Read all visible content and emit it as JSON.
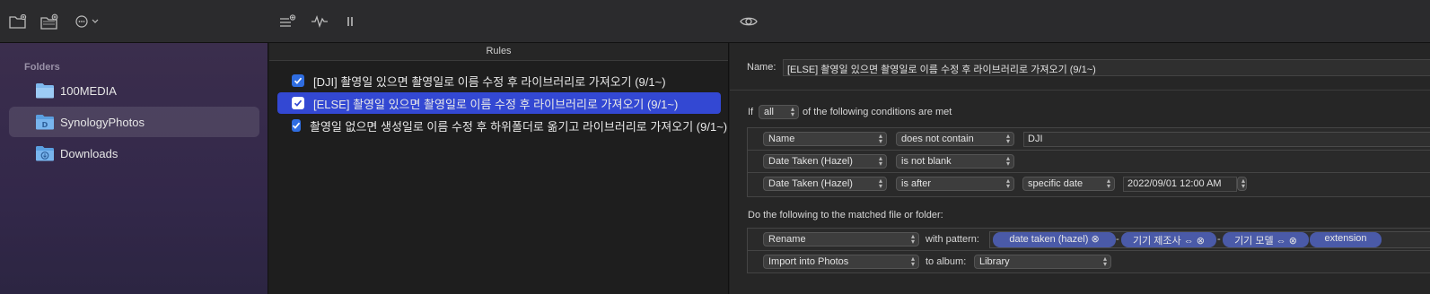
{
  "toolbar": {
    "icons": [
      "new-folder-icon",
      "add-folder-icon",
      "more-options-icon",
      "add-rule-icon",
      "activity-icon",
      "pause-icon",
      "preview-icon"
    ]
  },
  "sidebar": {
    "header": "Folders",
    "items": [
      {
        "label": "100MEDIA",
        "selected": false
      },
      {
        "label": "SynologyPhotos",
        "selected": true
      },
      {
        "label": "Downloads",
        "selected": false
      }
    ]
  },
  "rules": {
    "header": "Rules",
    "items": [
      {
        "label": "[DJI] 촬영일 있으면 촬영일로 이름 수정 후 라이브러리로 가져오기 (9/1~)",
        "checked": true,
        "selected": false
      },
      {
        "label": "[ELSE] 촬영일 있으면 촬영일로 이름 수정 후 라이브러리로 가져오기 (9/1~)",
        "checked": true,
        "selected": true
      },
      {
        "label": "촬영일 없으면 생성일로 이름 수정 후 하위폴더로 옮기고 라이브러리로 가져오기 (9/1~)",
        "checked": true,
        "selected": false
      }
    ]
  },
  "detail": {
    "name_label": "Name:",
    "name_value": "[ELSE] 촬영일 있으면 촬영일로 이름 수정 후 라이브러리로 가져오기 (9/1~)",
    "if_label": "If",
    "if_match": "all",
    "if_suffix": "of the following conditions are met",
    "conditions": [
      {
        "attribute": "Name",
        "operator": "does not contain",
        "value": "DJI"
      },
      {
        "attribute": "Date Taken (Hazel)",
        "operator": "is not blank"
      },
      {
        "attribute": "Date Taken (Hazel)",
        "operator": "is after",
        "qualifier": "specific date",
        "value": "2022/09/01 12:00 AM"
      }
    ],
    "actions_label": "Do the following to the matched file or folder:",
    "actions": [
      {
        "action": "Rename",
        "connector": "with pattern:",
        "tokens": [
          "date taken (hazel) ⊗",
          "기기 제조사 ⇔ ⊗",
          "기기 모델 ⇔ ⊗",
          "extension"
        ],
        "separator": "-"
      },
      {
        "action": "Import into Photos",
        "connector": "to album:",
        "target": "Library"
      }
    ]
  },
  "colors": {
    "accent": "#3348d3",
    "checkbox": "#2f6de1",
    "token": "#4a5aa8"
  }
}
